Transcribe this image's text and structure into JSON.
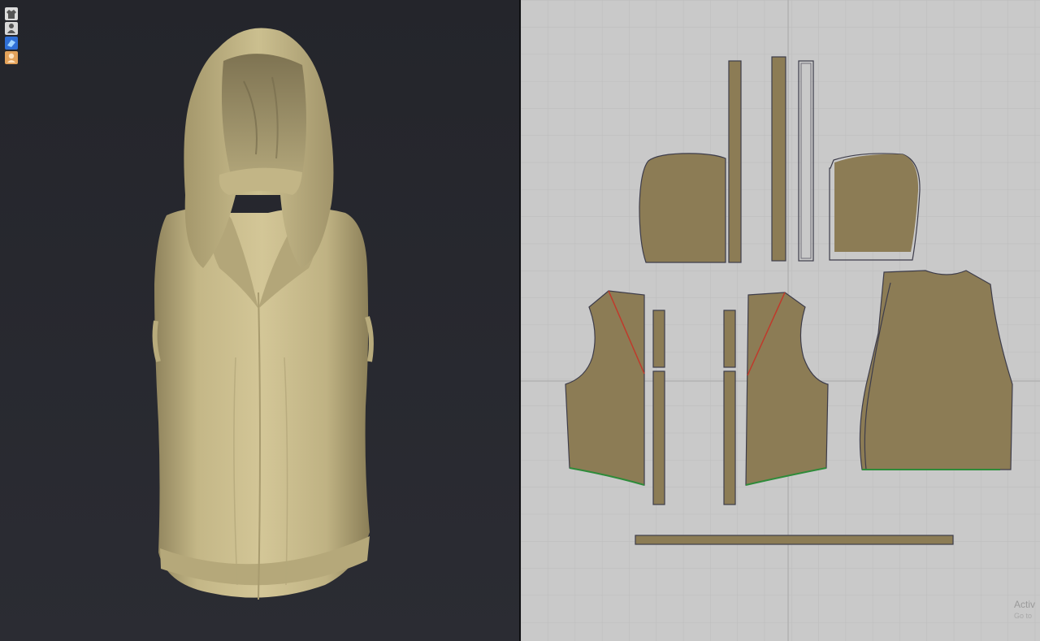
{
  "viewport_3d": {
    "toolbar": [
      {
        "icon": "garment-display-icon"
      },
      {
        "icon": "avatar-display-icon"
      },
      {
        "icon": "texture-display-icon"
      },
      {
        "icon": "skin-display-icon"
      }
    ]
  },
  "viewport_2d": {
    "watermark_line1": "Activ",
    "watermark_line2": "Go to"
  },
  "colors": {
    "fabric": "#8c7c55",
    "fabric_3d": "#c8bb8b",
    "grid_bg": "#c9c9c9",
    "seam_red": "#c0392b",
    "seam_green": "#2e8b3a",
    "outline": "#3d3c4a"
  }
}
